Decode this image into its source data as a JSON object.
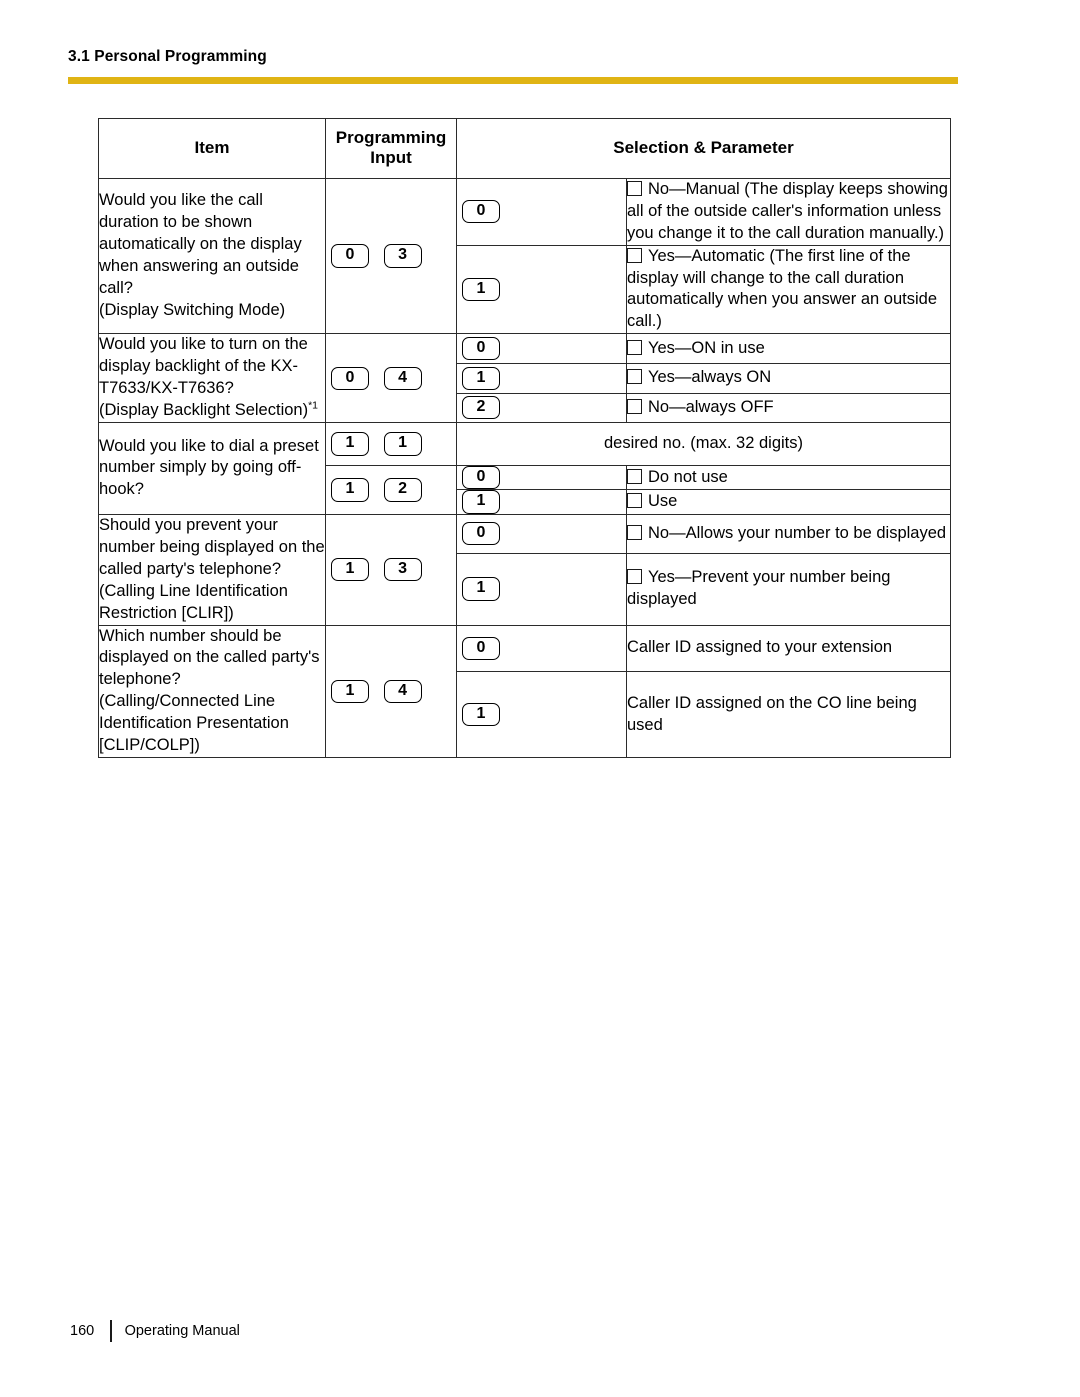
{
  "header": {
    "section_title": "3.1 Personal Programming",
    "rule_color": "#e0b414"
  },
  "table": {
    "columns": [
      "Item",
      "Programming Input",
      "Selection & Parameter"
    ],
    "headers": {
      "item": "Item",
      "programming_input_line1": "Programming",
      "programming_input_line2": "Input",
      "selection_parameter": "Selection & Parameter"
    },
    "rows": [
      {
        "item": "Would you like the call duration to be shown automatically on the display when answering an outside call?\n(Display Switching Mode)",
        "programming_input": [
          "0",
          "3"
        ],
        "options": [
          {
            "key": "0",
            "checkbox": true,
            "bold": false,
            "text": "No—Manual (The display keeps showing all of the outside caller's information unless you change it to the call duration manually.)"
          },
          {
            "key": "1",
            "checkbox": true,
            "bold": true,
            "text": "Yes—Automatic (The first line of the display will change to the call duration automatically when you answer an outside call.)"
          }
        ]
      },
      {
        "item": "Would you like to turn on the display backlight of the KX-T7633/KX-T7636?\n(Display Backlight Selection)*1",
        "item_footnote": "*1",
        "programming_input": [
          "0",
          "4"
        ],
        "options": [
          {
            "key": "0",
            "checkbox": true,
            "bold": false,
            "text": "Yes—ON in use"
          },
          {
            "key": "1",
            "checkbox": true,
            "bold": true,
            "text": "Yes—always ON"
          },
          {
            "key": "2",
            "checkbox": true,
            "bold": false,
            "text": "No—always OFF"
          }
        ]
      },
      {
        "item": "Would you like to dial a preset number simply by going off-hook?",
        "sub_rows": [
          {
            "programming_input": [
              "1",
              "1"
            ],
            "merged_text": "desired no. (max. 32 digits)"
          },
          {
            "programming_input": [
              "1",
              "2"
            ],
            "options": [
              {
                "key": "0",
                "checkbox": true,
                "bold": true,
                "text": "Do not use"
              },
              {
                "key": "1",
                "checkbox": true,
                "bold": false,
                "text": "Use"
              }
            ]
          }
        ]
      },
      {
        "item": "Should you prevent your number being displayed on the called party's telephone?\n(Calling Line Identification Restriction [CLIR])",
        "programming_input": [
          "1",
          "3"
        ],
        "options": [
          {
            "key": "0",
            "checkbox": true,
            "bold": true,
            "text": "No—Allows your number to be displayed"
          },
          {
            "key": "1",
            "checkbox": true,
            "bold": false,
            "text": "Yes—Prevent your number being displayed"
          }
        ]
      },
      {
        "item": "Which number should be displayed on the called party's telephone? (Calling/Connected Line Identification Presentation [CLIP/COLP])",
        "programming_input": [
          "1",
          "4"
        ],
        "options": [
          {
            "key": "0",
            "checkbox": false,
            "bold": true,
            "text": "Caller ID assigned to your extension"
          },
          {
            "key": "1",
            "checkbox": false,
            "bold": false,
            "text": "Caller ID assigned on the CO line being used"
          }
        ]
      }
    ]
  },
  "footer": {
    "page_number": "160",
    "document_title": "Operating Manual"
  }
}
